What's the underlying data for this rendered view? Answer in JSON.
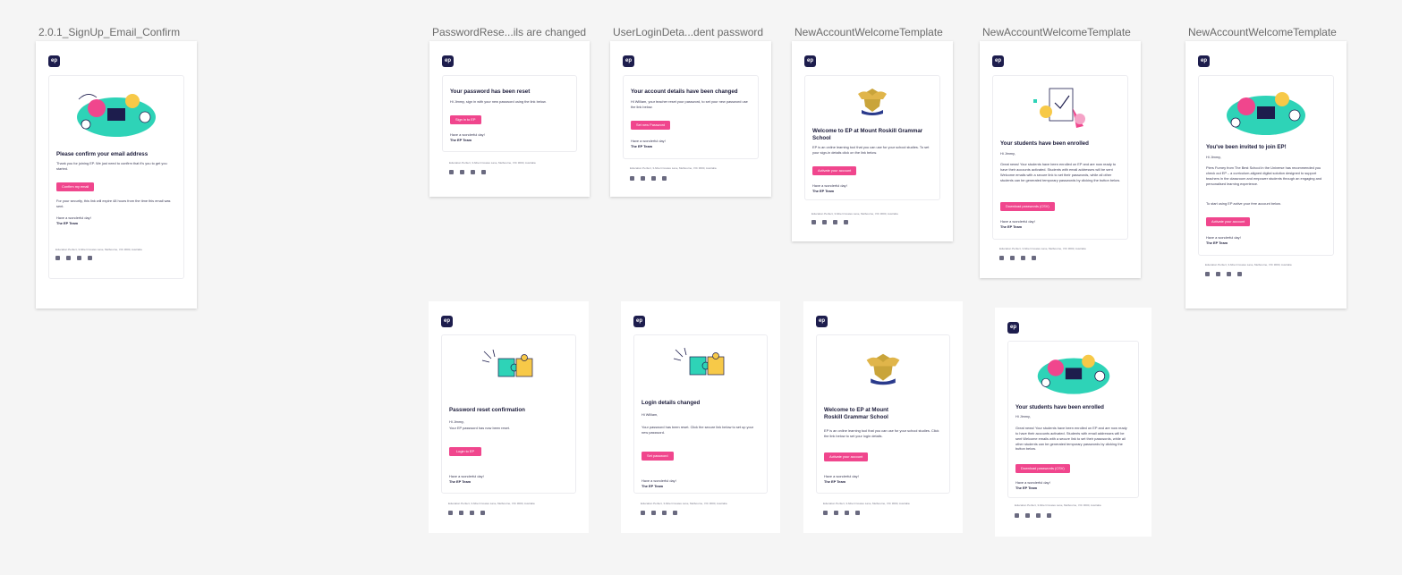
{
  "footer_address": "Education Perfect, 3 Albert Coates Lane, Melbourne, VIC 3000, Australia",
  "logo_text": "ep",
  "social_icons": [
    "facebook-icon",
    "twitter-icon",
    "instagram-icon",
    "linkedin-icon"
  ],
  "frames": {
    "signup": {
      "title": "2.0.1_SignUp_Email_Confirm",
      "heading": "Please confirm your email address",
      "body": "Thank you for joining EP. We just need to confirm that it's you to get you started.",
      "button": "Confirm my email",
      "note": "For your security, this link will expire 48 hours from the time this email was sent.",
      "signoff_line": "Have a wonderful day!",
      "signoff_name": "The EP Team"
    },
    "pw_reset": {
      "title": "PasswordRese...ils are changed",
      "heading": "Your password has been reset",
      "body": "Hi Jimmy, sign in with your new password using the link below.",
      "button": "Sign in to EP",
      "signoff_line": "Have a wonderful day!",
      "signoff_name": "The EP Team"
    },
    "user_login": {
      "title": "UserLoginDeta...dent password",
      "heading": "Your account details have been changed",
      "body": "Hi William, your teacher reset your password, to set your new password use the link below.",
      "button": "Set new Password",
      "signoff_line": "Have a wonderful day!",
      "signoff_name": "The EP Team"
    },
    "welcome1": {
      "title": "NewAccountWelcomeTemplate",
      "heading": "Welcome to EP at Mount Roskill Grammar School",
      "body": "EP is an online learning tool that you can use for your school studies. To set your sign-in details click on the link below.",
      "button": "Activate your account",
      "signoff_line": "Have a wonderful day!",
      "signoff_name": "The EP Team"
    },
    "welcome2": {
      "title": "NewAccountWelcomeTemplate",
      "heading": "Your students have been enrolled",
      "greeting": "Hi Jimmy,",
      "body": "Great news! Your students have been enrolled on EP and are now ready to have their accounts activated. Students with email addresses will be sent Welcome emails with a secure link to set their passwords, while all other students can be generated temporary passwords by clicking the button below.",
      "button": "Download passwords (CSV)",
      "signoff_line": "Have a wonderful day!",
      "signoff_name": "The EP Team"
    },
    "welcome3": {
      "title": "NewAccountWelcomeTemplate",
      "heading": "You've been invited to join EP!",
      "greeting": "Hi Jimmy,",
      "body": "Piers Furney from The Best School in the Universe has recommended you check out EP – a curriculum-aligned digital solution designed to support teachers in the classroom and empower students through an engaging and personalised learning experience.",
      "body2": "To start using EP active your free account below.",
      "button": "Activate your account",
      "signoff_line": "Have a wonderful day!",
      "signoff_name": "The EP Team"
    },
    "pw_confirm": {
      "heading": "Password reset confirmation",
      "greeting": "Hi Jimmy,",
      "body": "Your EP password has now been reset.",
      "button": "Login to EP",
      "signoff_line": "Have a wonderful day!",
      "signoff_name": "The EP Team"
    },
    "login_changed": {
      "heading": "Login details changed",
      "greeting": "Hi William,",
      "body": "Your password has been reset. Click the secure link below to set up your new password.",
      "button": "Set password",
      "signoff_line": "Have a wonderful day!",
      "signoff_name": "The EP Team"
    },
    "welcome4": {
      "heading": "Welcome to EP at Mount Roskill Grammar School",
      "body": "EP is an online learning tool that you can use for your school studies. Click the link below to set your login details.",
      "button": "Activate your account",
      "signoff_line": "Have a wonderful day!",
      "signoff_name": "The EP Team"
    },
    "enrolled2": {
      "heading": "Your students have been enrolled",
      "greeting": "Hi Jimmy,",
      "body": "Great news! Your students have been enrolled on EP and are now ready to have their accounts activated. Students with email addresses will be sent Welcome emails with a secure link to set their passwords, while all other students can be generated temporary passwords by clicking the button below.",
      "button": "Download passwords (CSV)",
      "signoff_line": "Have a wonderful day!",
      "signoff_name": "The EP Team"
    }
  }
}
